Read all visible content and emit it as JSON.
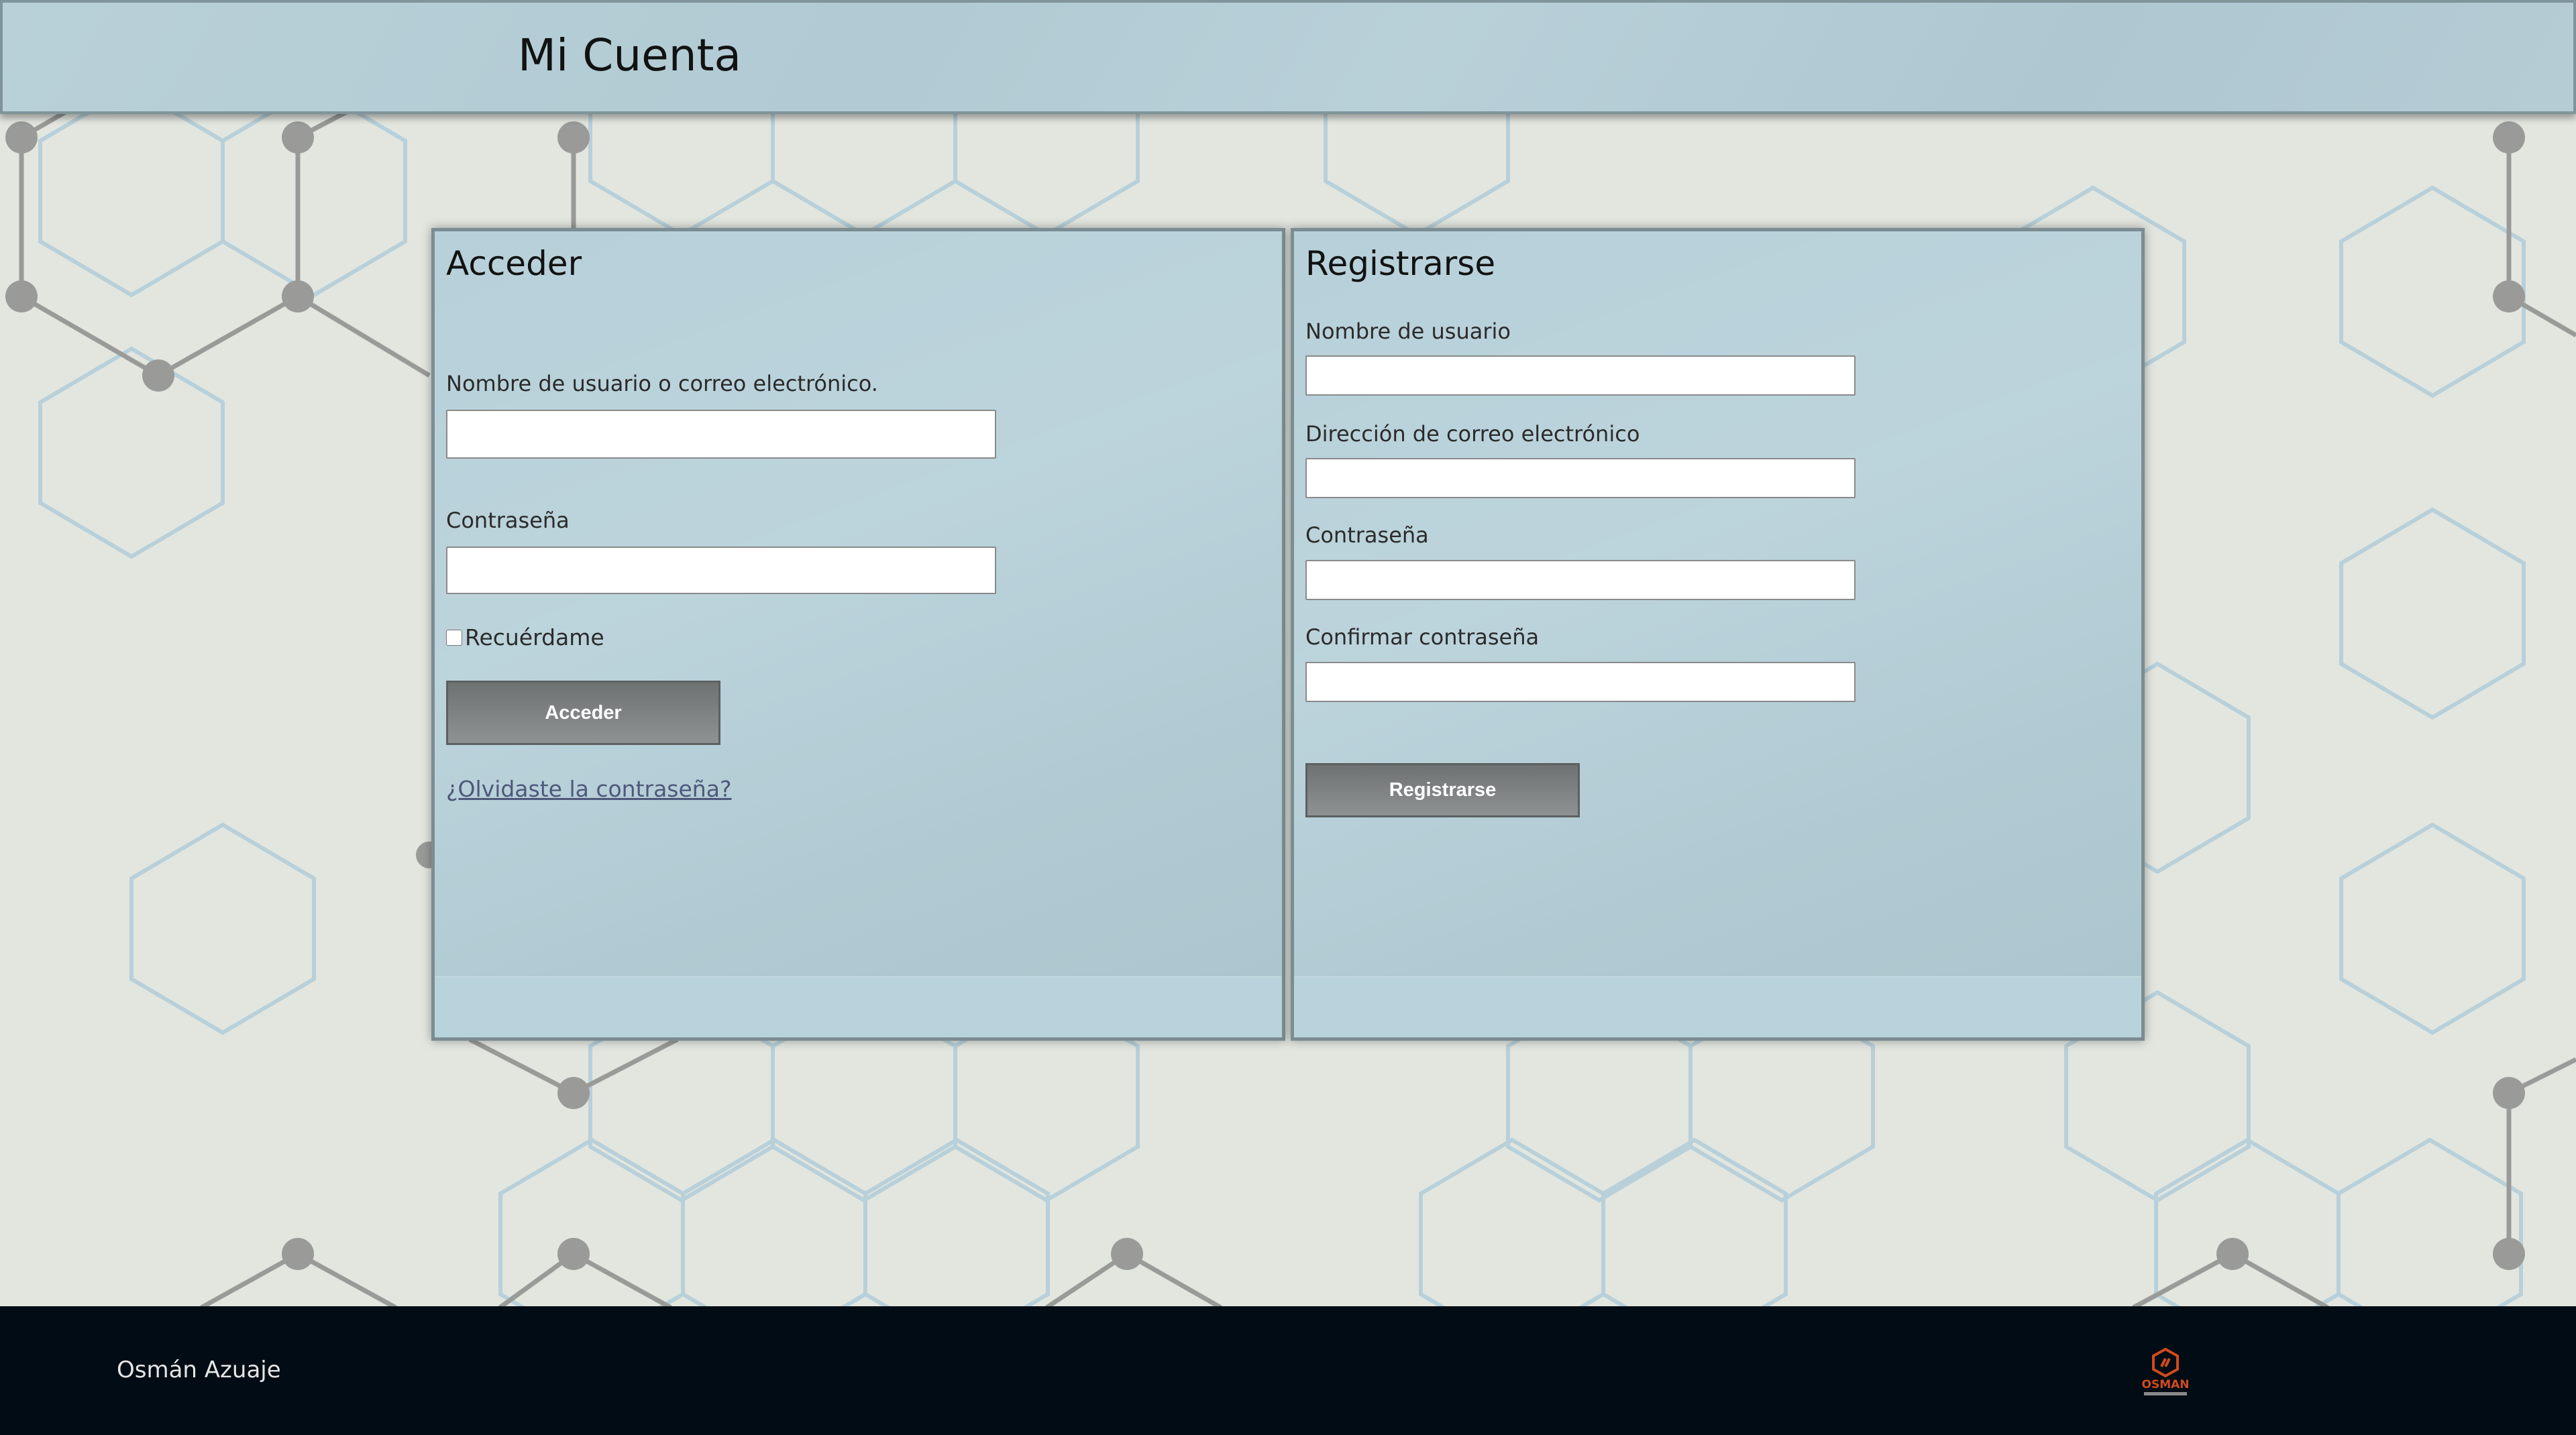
{
  "header": {
    "title": "Mi Cuenta"
  },
  "login": {
    "heading": "Acceder",
    "username_label": "Nombre de usuario o correo electrónico.",
    "username_value": "",
    "password_label": "Contraseña",
    "password_value": "",
    "remember_label": "Recuérdame",
    "remember_checked": false,
    "submit_label": "Acceder",
    "forgot_link": "¿Olvidaste la contraseña?"
  },
  "register": {
    "heading": "Registrarse",
    "username_label": "Nombre de usuario",
    "username_value": "",
    "email_label": "Dirección de correo electrónico",
    "email_value": "",
    "password_label": "Contraseña",
    "password_value": "",
    "confirm_label": "Confirmar contraseña",
    "confirm_value": "",
    "submit_label": "Registrarse"
  },
  "footer": {
    "author": "Osmán Azuaje",
    "logo_icon": "osman-logo-icon",
    "logo_text": "OSMAN"
  },
  "colors": {
    "background": "#e2e6df",
    "panel": "#b7d0d9",
    "header": "#b9d0d8",
    "footer": "#010c14",
    "button": "#7a7e7e",
    "link": "#4e587a",
    "logo_accent": "#d24a1e"
  }
}
